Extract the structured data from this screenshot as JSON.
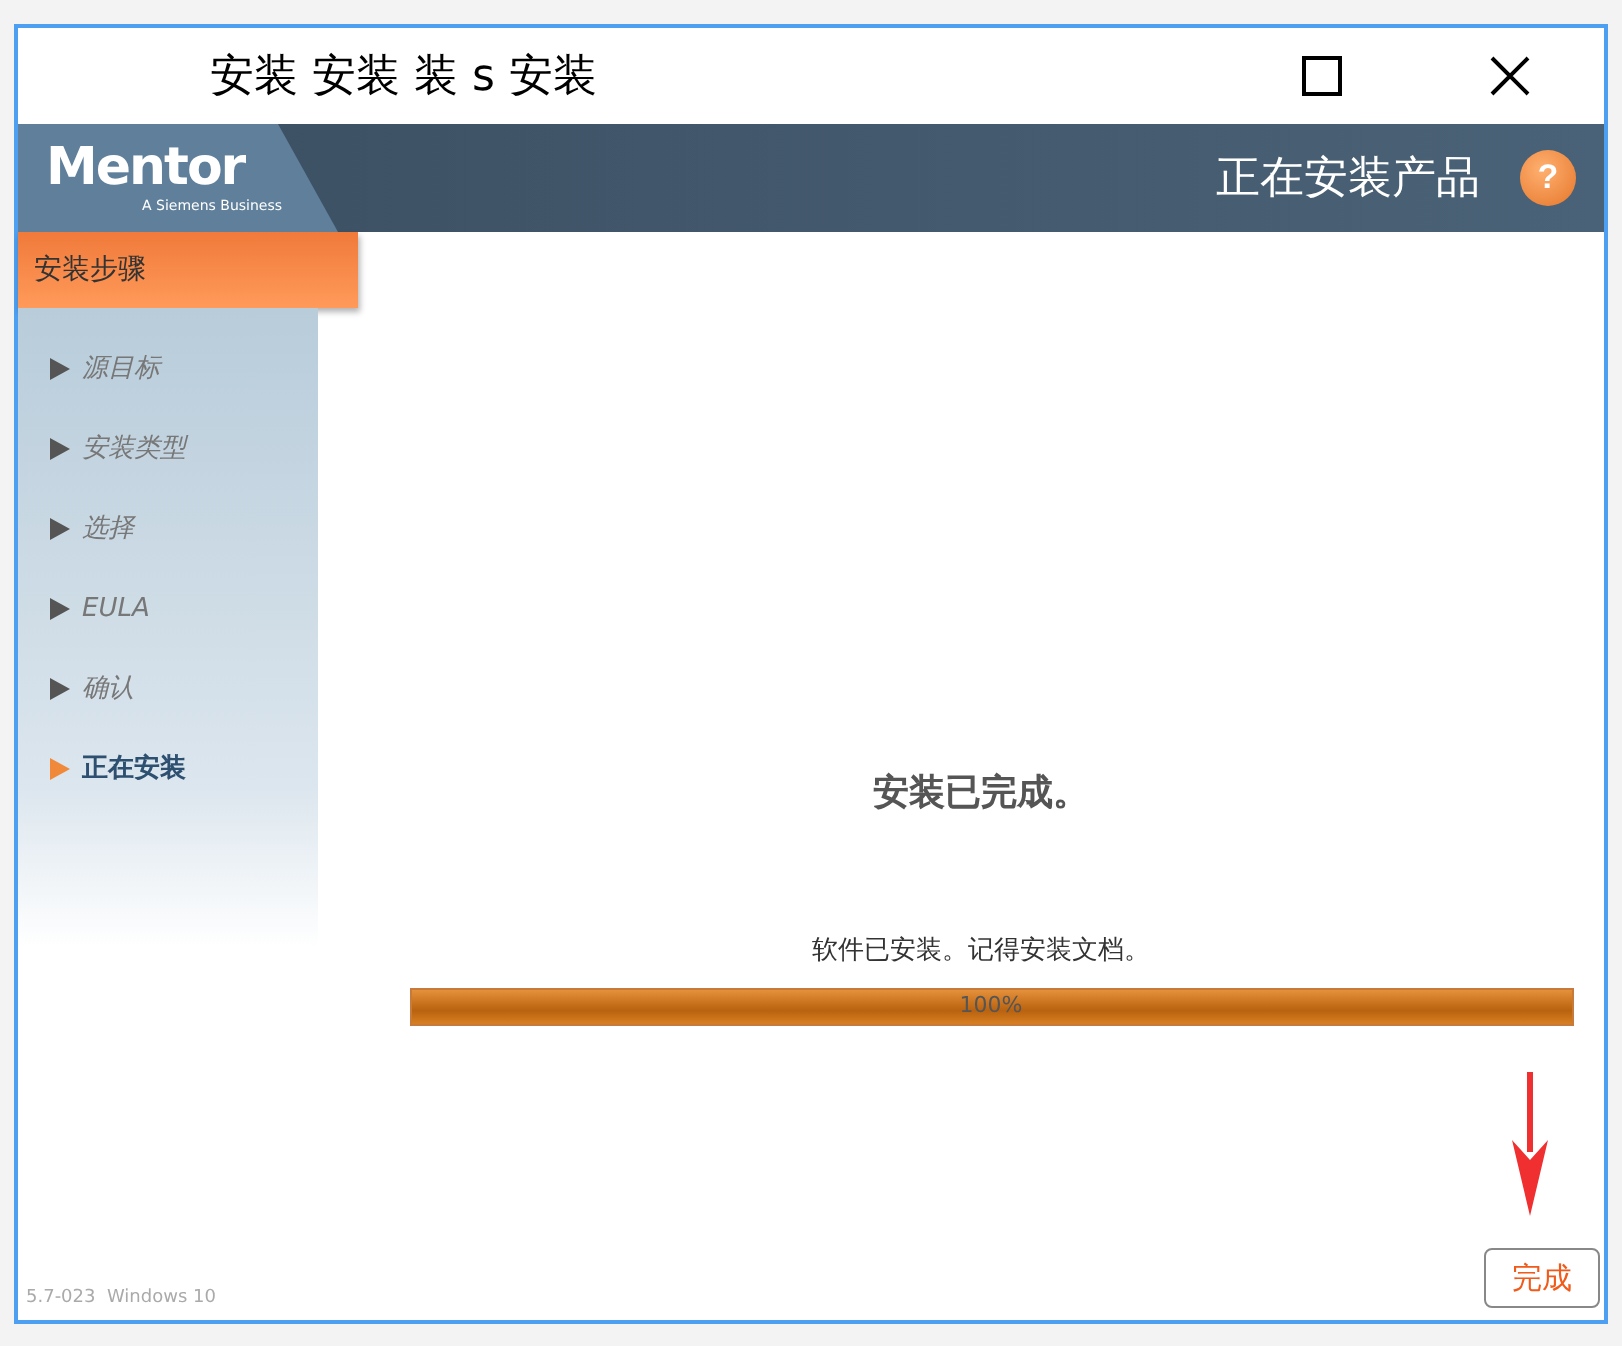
{
  "window": {
    "title": "安装 安装 装 s 安装"
  },
  "header": {
    "logo": "Mentor",
    "logo_tagline": "A Siemens Business",
    "title": "正在安装产品",
    "help": "?"
  },
  "sidebar": {
    "heading": "安装步骤",
    "steps": [
      {
        "label": "源目标",
        "selected": false
      },
      {
        "label": "安装类型",
        "selected": false
      },
      {
        "label": "选择",
        "selected": false
      },
      {
        "label": "EULA",
        "selected": false
      },
      {
        "label": "确认",
        "selected": false
      },
      {
        "label": "正在安装",
        "selected": true
      }
    ],
    "version": "5.7-023  Windows 10"
  },
  "content": {
    "status": "安装已完成。",
    "message": "软件已安装。记得安装文档。",
    "progress": {
      "level": 1,
      "reading": "100%"
    }
  },
  "buttons": [
    {
      "label": "完成"
    }
  ]
}
